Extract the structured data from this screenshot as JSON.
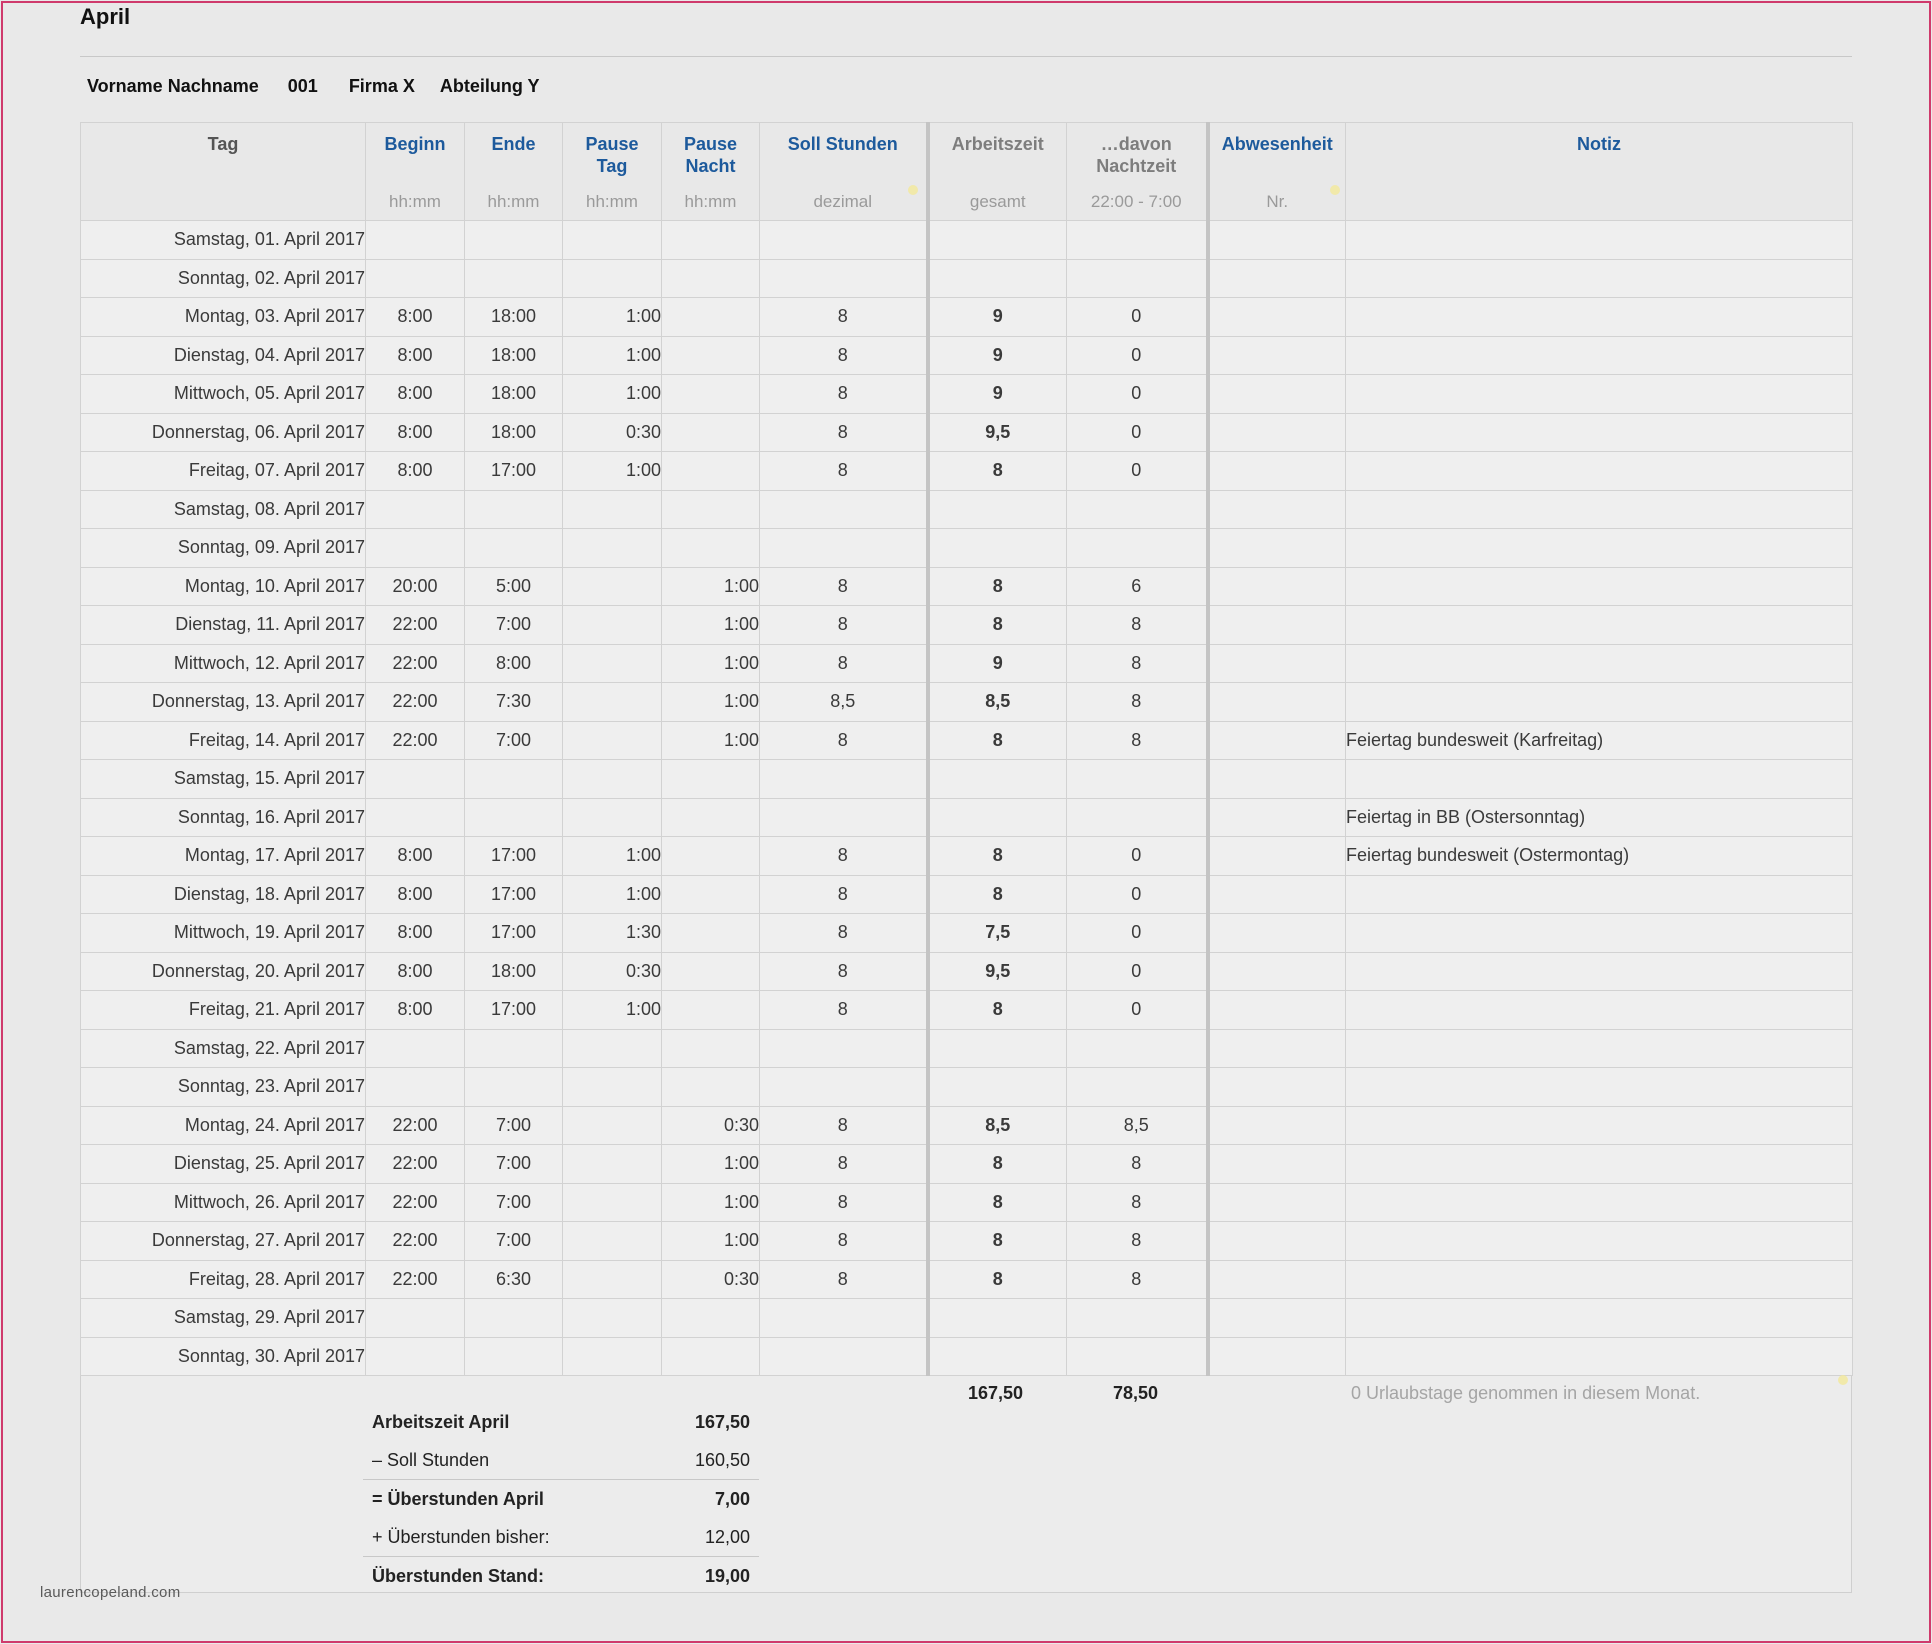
{
  "month_title": "April",
  "employee": {
    "name": "Vorname Nachname",
    "number": "001",
    "company": "Firma X",
    "department": "Abteilung Y"
  },
  "headers": {
    "tag": "Tag",
    "beginn": "Beginn",
    "beginn_unit": "hh:mm",
    "ende": "Ende",
    "ende_unit": "hh:mm",
    "pause_tag_1": "Pause",
    "pause_tag_2": "Tag",
    "pause_tag_unit": "hh:mm",
    "pause_nacht_1": "Pause",
    "pause_nacht_2": "Nacht",
    "pause_nacht_unit": "hh:mm",
    "soll": "Soll Stunden",
    "soll_unit": "dezimal",
    "arbeitszeit": "Arbeitszeit",
    "arbeitszeit_unit": "gesamt",
    "nacht_1": "…davon",
    "nacht_2": "Nachtzeit",
    "nacht_unit": "22:00 - 7:00",
    "abwesenheit": "Abwesenheit",
    "abwesenheit_unit": "Nr.",
    "notiz": "Notiz"
  },
  "rows": [
    {
      "day": "Samstag, 01. April 2017",
      "beginn": "",
      "ende": "",
      "pause_tag": "",
      "pause_nacht": "",
      "soll": "",
      "arbeitszeit": "",
      "nacht": "",
      "abwesenheit": "",
      "notiz": ""
    },
    {
      "day": "Sonntag, 02. April 2017",
      "beginn": "",
      "ende": "",
      "pause_tag": "",
      "pause_nacht": "",
      "soll": "",
      "arbeitszeit": "",
      "nacht": "",
      "abwesenheit": "",
      "notiz": ""
    },
    {
      "day": "Montag, 03. April 2017",
      "beginn": "8:00",
      "ende": "18:00",
      "pause_tag": "1:00",
      "pause_nacht": "",
      "soll": "8",
      "arbeitszeit": "9",
      "nacht": "0",
      "abwesenheit": "",
      "notiz": ""
    },
    {
      "day": "Dienstag, 04. April 2017",
      "beginn": "8:00",
      "ende": "18:00",
      "pause_tag": "1:00",
      "pause_nacht": "",
      "soll": "8",
      "arbeitszeit": "9",
      "nacht": "0",
      "abwesenheit": "",
      "notiz": ""
    },
    {
      "day": "Mittwoch, 05. April 2017",
      "beginn": "8:00",
      "ende": "18:00",
      "pause_tag": "1:00",
      "pause_nacht": "",
      "soll": "8",
      "arbeitszeit": "9",
      "nacht": "0",
      "abwesenheit": "",
      "notiz": ""
    },
    {
      "day": "Donnerstag, 06. April 2017",
      "beginn": "8:00",
      "ende": "18:00",
      "pause_tag": "0:30",
      "pause_nacht": "",
      "soll": "8",
      "arbeitszeit": "9,5",
      "nacht": "0",
      "abwesenheit": "",
      "notiz": ""
    },
    {
      "day": "Freitag, 07. April 2017",
      "beginn": "8:00",
      "ende": "17:00",
      "pause_tag": "1:00",
      "pause_nacht": "",
      "soll": "8",
      "arbeitszeit": "8",
      "nacht": "0",
      "abwesenheit": "",
      "notiz": ""
    },
    {
      "day": "Samstag, 08. April 2017",
      "beginn": "",
      "ende": "",
      "pause_tag": "",
      "pause_nacht": "",
      "soll": "",
      "arbeitszeit": "",
      "nacht": "",
      "abwesenheit": "",
      "notiz": ""
    },
    {
      "day": "Sonntag, 09. April 2017",
      "beginn": "",
      "ende": "",
      "pause_tag": "",
      "pause_nacht": "",
      "soll": "",
      "arbeitszeit": "",
      "nacht": "",
      "abwesenheit": "",
      "notiz": ""
    },
    {
      "day": "Montag, 10. April 2017",
      "beginn": "20:00",
      "ende": "5:00",
      "pause_tag": "",
      "pause_nacht": "1:00",
      "soll": "8",
      "arbeitszeit": "8",
      "nacht": "6",
      "abwesenheit": "",
      "notiz": ""
    },
    {
      "day": "Dienstag, 11. April 2017",
      "beginn": "22:00",
      "ende": "7:00",
      "pause_tag": "",
      "pause_nacht": "1:00",
      "soll": "8",
      "arbeitszeit": "8",
      "nacht": "8",
      "abwesenheit": "",
      "notiz": ""
    },
    {
      "day": "Mittwoch, 12. April 2017",
      "beginn": "22:00",
      "ende": "8:00",
      "pause_tag": "",
      "pause_nacht": "1:00",
      "soll": "8",
      "arbeitszeit": "9",
      "nacht": "8",
      "abwesenheit": "",
      "notiz": ""
    },
    {
      "day": "Donnerstag, 13. April 2017",
      "beginn": "22:00",
      "ende": "7:30",
      "pause_tag": "",
      "pause_nacht": "1:00",
      "soll": "8,5",
      "arbeitszeit": "8,5",
      "nacht": "8",
      "abwesenheit": "",
      "notiz": ""
    },
    {
      "day": "Freitag, 14. April 2017",
      "beginn": "22:00",
      "ende": "7:00",
      "pause_tag": "",
      "pause_nacht": "1:00",
      "soll": "8",
      "arbeitszeit": "8",
      "nacht": "8",
      "abwesenheit": "",
      "notiz": "Feiertag bundesweit (Karfreitag)"
    },
    {
      "day": "Samstag, 15. April 2017",
      "beginn": "",
      "ende": "",
      "pause_tag": "",
      "pause_nacht": "",
      "soll": "",
      "arbeitszeit": "",
      "nacht": "",
      "abwesenheit": "",
      "notiz": ""
    },
    {
      "day": "Sonntag, 16. April 2017",
      "beginn": "",
      "ende": "",
      "pause_tag": "",
      "pause_nacht": "",
      "soll": "",
      "arbeitszeit": "",
      "nacht": "",
      "abwesenheit": "",
      "notiz": "Feiertag in BB (Ostersonntag)"
    },
    {
      "day": "Montag, 17. April 2017",
      "beginn": "8:00",
      "ende": "17:00",
      "pause_tag": "1:00",
      "pause_nacht": "",
      "soll": "8",
      "arbeitszeit": "8",
      "nacht": "0",
      "abwesenheit": "",
      "notiz": "Feiertag bundesweit (Ostermontag)"
    },
    {
      "day": "Dienstag, 18. April 2017",
      "beginn": "8:00",
      "ende": "17:00",
      "pause_tag": "1:00",
      "pause_nacht": "",
      "soll": "8",
      "arbeitszeit": "8",
      "nacht": "0",
      "abwesenheit": "",
      "notiz": ""
    },
    {
      "day": "Mittwoch, 19. April 2017",
      "beginn": "8:00",
      "ende": "17:00",
      "pause_tag": "1:30",
      "pause_nacht": "",
      "soll": "8",
      "arbeitszeit": "7,5",
      "nacht": "0",
      "abwesenheit": "",
      "notiz": ""
    },
    {
      "day": "Donnerstag, 20. April 2017",
      "beginn": "8:00",
      "ende": "18:00",
      "pause_tag": "0:30",
      "pause_nacht": "",
      "soll": "8",
      "arbeitszeit": "9,5",
      "nacht": "0",
      "abwesenheit": "",
      "notiz": ""
    },
    {
      "day": "Freitag, 21. April 2017",
      "beginn": "8:00",
      "ende": "17:00",
      "pause_tag": "1:00",
      "pause_nacht": "",
      "soll": "8",
      "arbeitszeit": "8",
      "nacht": "0",
      "abwesenheit": "",
      "notiz": ""
    },
    {
      "day": "Samstag, 22. April 2017",
      "beginn": "",
      "ende": "",
      "pause_tag": "",
      "pause_nacht": "",
      "soll": "",
      "arbeitszeit": "",
      "nacht": "",
      "abwesenheit": "",
      "notiz": ""
    },
    {
      "day": "Sonntag, 23. April 2017",
      "beginn": "",
      "ende": "",
      "pause_tag": "",
      "pause_nacht": "",
      "soll": "",
      "arbeitszeit": "",
      "nacht": "",
      "abwesenheit": "",
      "notiz": ""
    },
    {
      "day": "Montag, 24. April 2017",
      "beginn": "22:00",
      "ende": "7:00",
      "pause_tag": "",
      "pause_nacht": "0:30",
      "soll": "8",
      "arbeitszeit": "8,5",
      "nacht": "8,5",
      "abwesenheit": "",
      "notiz": ""
    },
    {
      "day": "Dienstag, 25. April 2017",
      "beginn": "22:00",
      "ende": "7:00",
      "pause_tag": "",
      "pause_nacht": "1:00",
      "soll": "8",
      "arbeitszeit": "8",
      "nacht": "8",
      "abwesenheit": "",
      "notiz": ""
    },
    {
      "day": "Mittwoch, 26. April 2017",
      "beginn": "22:00",
      "ende": "7:00",
      "pause_tag": "",
      "pause_nacht": "1:00",
      "soll": "8",
      "arbeitszeit": "8",
      "nacht": "8",
      "abwesenheit": "",
      "notiz": ""
    },
    {
      "day": "Donnerstag, 27. April 2017",
      "beginn": "22:00",
      "ende": "7:00",
      "pause_tag": "",
      "pause_nacht": "1:00",
      "soll": "8",
      "arbeitszeit": "8",
      "nacht": "8",
      "abwesenheit": "",
      "notiz": ""
    },
    {
      "day": "Freitag, 28. April 2017",
      "beginn": "22:00",
      "ende": "6:30",
      "pause_tag": "",
      "pause_nacht": "0:30",
      "soll": "8",
      "arbeitszeit": "8",
      "nacht": "8",
      "abwesenheit": "",
      "notiz": ""
    },
    {
      "day": "Samstag, 29. April 2017",
      "beginn": "",
      "ende": "",
      "pause_tag": "",
      "pause_nacht": "",
      "soll": "",
      "arbeitszeit": "",
      "nacht": "",
      "abwesenheit": "",
      "notiz": ""
    },
    {
      "day": "Sonntag, 30. April 2017",
      "beginn": "",
      "ende": "",
      "pause_tag": "",
      "pause_nacht": "",
      "soll": "",
      "arbeitszeit": "",
      "nacht": "",
      "abwesenheit": "",
      "notiz": ""
    }
  ],
  "totals": {
    "arbeitszeit": "167,50",
    "nachtzeit": "78,50",
    "urlaub_note": "0 Urlaubstage genommen in diesem Monat."
  },
  "summary": [
    {
      "label": "Arbeitszeit April",
      "value": "167,50"
    },
    {
      "label": "– Soll Stunden",
      "value": "160,50"
    },
    {
      "label": "= Überstunden April",
      "value": "7,00"
    },
    {
      "label": "+ Überstunden bisher:",
      "value": "12,00"
    },
    {
      "label": "Überstunden Stand:",
      "value": "19,00"
    }
  ],
  "watermark": "laurencopeland.com",
  "colors": {
    "header_blue": "#1d5a9c",
    "frame_border": "#cf3a6c",
    "faint_zero": "#cfcfcf"
  }
}
